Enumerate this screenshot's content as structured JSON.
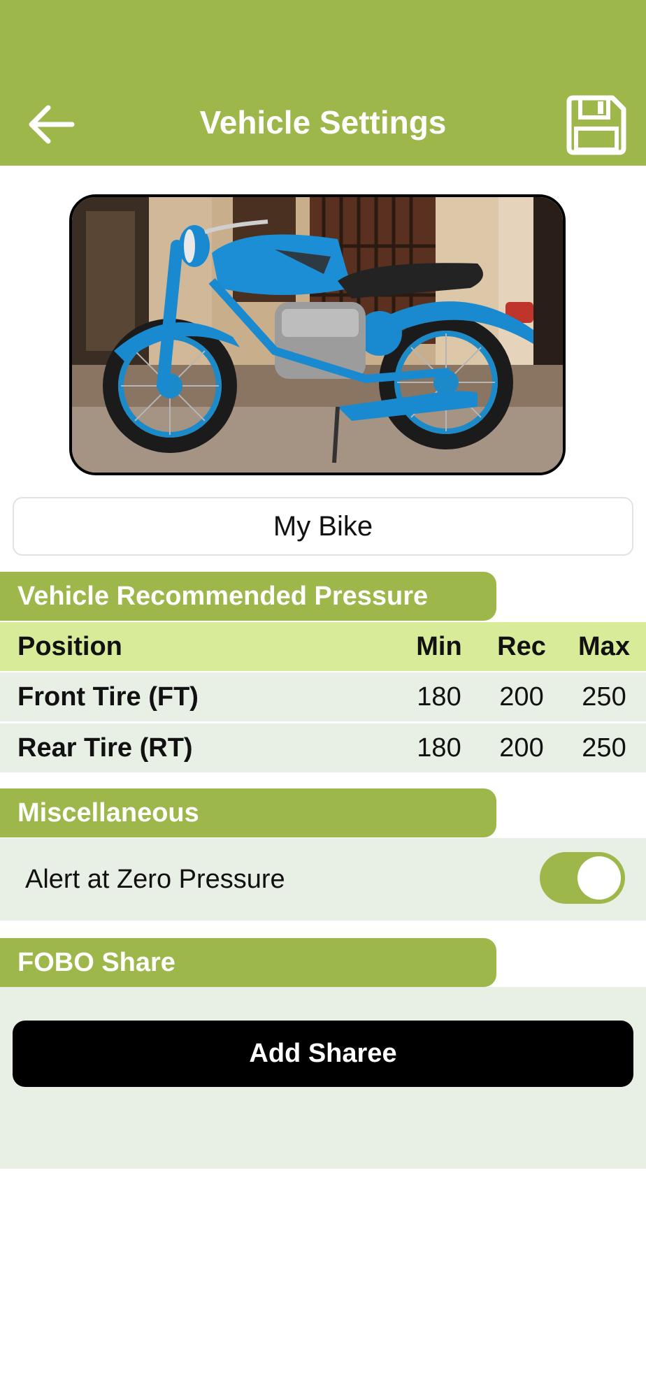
{
  "header": {
    "title": "Vehicle Settings",
    "back_icon": "arrow-left-icon",
    "save_icon": "floppy-disk-icon",
    "color": "#9db74b"
  },
  "vehicle": {
    "photo_icon": "motorcycle-photo",
    "name_value": "My Bike"
  },
  "pressure": {
    "section_title": "Vehicle Recommended Pressure",
    "columns": [
      "Position",
      "Min",
      "Rec",
      "Max"
    ],
    "rows": [
      {
        "position": "Front Tire (FT)",
        "min": "180",
        "rec": "200",
        "max": "250"
      },
      {
        "position": "Rear Tire (RT)",
        "min": "180",
        "rec": "200",
        "max": "250"
      }
    ]
  },
  "misc": {
    "section_title": "Miscellaneous",
    "alert_label": "Alert at Zero Pressure",
    "alert_enabled": true
  },
  "fobo": {
    "section_title": "FOBO Share",
    "add_button": "Add Sharee"
  },
  "colors": {
    "accent": "#9db74b",
    "table_header": "#d8eb98",
    "row_bg": "#e8efe4",
    "button": "#000000"
  }
}
